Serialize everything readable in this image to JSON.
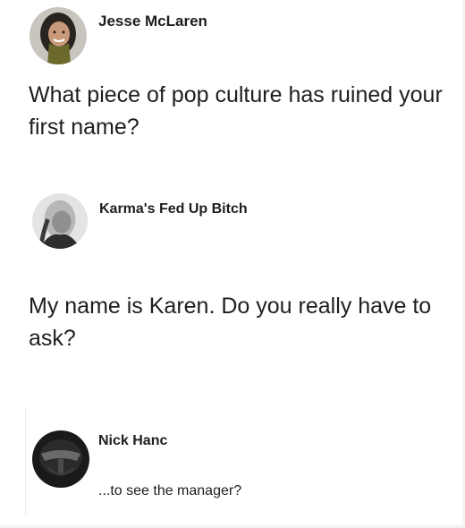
{
  "posts": [
    {
      "author": "Jesse McLaren",
      "text": "What piece of pop culture has ruined your first name?",
      "avatar_icon": "person-photo-icon"
    },
    {
      "author": "Karma's Fed Up Bitch",
      "text": "My name is Karen. Do you really have to ask?",
      "avatar_icon": "person-photo-icon"
    },
    {
      "author": "Nick Hanc",
      "text": "...to see the manager?",
      "avatar_icon": "mask-photo-icon"
    }
  ],
  "colors": {
    "text": "#1c1e21",
    "background": "#ffffff"
  }
}
